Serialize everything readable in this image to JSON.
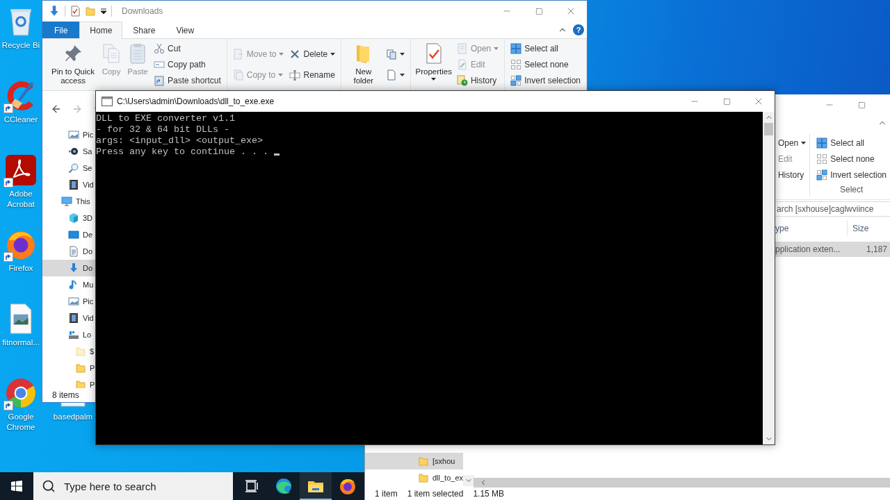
{
  "desktop_icons": [
    {
      "label": "Recycle Bi",
      "kind": "bin",
      "shortcut": false
    },
    {
      "label": "CCleaner",
      "kind": "cleaner",
      "shortcut": true
    },
    {
      "label": "Adobe Acrobat",
      "kind": "pdf",
      "shortcut": true
    },
    {
      "label": "Firefox",
      "kind": "foxbrowser",
      "shortcut": true
    },
    {
      "label": "fitnormal...",
      "kind": "image",
      "shortcut": false
    },
    {
      "label": "Google Chrome",
      "kind": "browser",
      "shortcut": true
    },
    {
      "label": "basedpalm",
      "kind": "file",
      "shortcut": false
    }
  ],
  "taskbar": {
    "search": {
      "placeholder": "Type here to search"
    },
    "apps": [
      {
        "kind": "taskview",
        "active": false
      },
      {
        "kind": "edge",
        "active": false
      },
      {
        "kind": "explorer",
        "active": true
      },
      {
        "kind": "firefox",
        "active": false
      }
    ]
  },
  "explorer_back": {
    "ribbon": {
      "open_items": [
        {
          "label": "Open",
          "dropdown": true,
          "disabled": false
        },
        {
          "label": "Edit",
          "dropdown": false,
          "disabled": true
        },
        {
          "label": "History",
          "dropdown": false,
          "disabled": false
        }
      ],
      "select_group": {
        "label": "Select",
        "items": [
          {
            "label": "Select all",
            "kind": "select-all"
          },
          {
            "label": "Select none",
            "kind": "select-none"
          },
          {
            "label": "Invert selection",
            "kind": "invert-selection"
          }
        ]
      }
    },
    "search": {
      "value": "arch [sxhouse]caglwviince"
    },
    "columns": [
      "ype",
      "Size"
    ],
    "rows": [
      {
        "cells": [
          "pplication exten...",
          "1,187"
        ],
        "selected": true
      }
    ],
    "nav_items": [
      {
        "label": "[sxhou",
        "selected": true
      },
      {
        "label": "dll_to_ex",
        "selected": false
      }
    ],
    "status": [
      "1 item",
      "1 item selected",
      "1.15 MB"
    ]
  },
  "explorer_front": {
    "title": "Downloads",
    "tabs": [
      {
        "label": "File",
        "kind": "file",
        "selected": false
      },
      {
        "label": "Home",
        "kind": "tab",
        "selected": true
      },
      {
        "label": "Share",
        "kind": "tab",
        "selected": false
      },
      {
        "label": "View",
        "kind": "tab",
        "selected": false
      }
    ],
    "help": "?",
    "ribbon": [
      {
        "columns": [
          {
            "large": {
              "label": "Pin to Quick access",
              "kind": "pin",
              "dropdown": false,
              "disabled": false
            }
          },
          {
            "large": {
              "label": "Copy",
              "kind": "copy",
              "dropdown": false,
              "disabled": true
            }
          },
          {
            "large": {
              "label": "Paste",
              "kind": "paste",
              "dropdown": false,
              "disabled": true
            }
          },
          {
            "stack": [
              {
                "label": "Cut",
                "kind": "cut",
                "dropdown": false,
                "disabled": false
              },
              {
                "label": "Copy path",
                "kind": "copy-path",
                "dropdown": false,
                "disabled": false
              },
              {
                "label": "Paste shortcut",
                "kind": "paste-shortcut",
                "dropdown": false,
                "disabled": false
              }
            ]
          }
        ]
      },
      {
        "columns": [
          {
            "stack": [
              {
                "label": "Move to",
                "kind": "move-to",
                "dropdown": true,
                "disabled": true
              },
              {
                "label": "Copy to",
                "kind": "copy-to",
                "dropdown": true,
                "disabled": true
              }
            ]
          },
          {
            "stack": [
              {
                "label": "Delete",
                "kind": "delete",
                "dropdown": true,
                "disabled": false
              },
              {
                "label": "Rename",
                "kind": "rename",
                "dropdown": false,
                "disabled": false
              }
            ]
          }
        ]
      },
      {
        "columns": [
          {
            "large": {
              "label": "New folder",
              "kind": "new-folder",
              "dropdown": false,
              "disabled": false
            }
          },
          {
            "stack": [
              {
                "kind": "new-item",
                "dropdown": true,
                "disabled": false
              },
              {
                "kind": "easy-access",
                "dropdown": true,
                "disabled": false
              }
            ]
          }
        ]
      },
      {
        "columns": [
          {
            "large": {
              "label": "Properties",
              "kind": "properties",
              "dropdown": true,
              "disabled": false
            }
          },
          {
            "stack": [
              {
                "label": "Open",
                "kind": "open",
                "dropdown": true,
                "disabled": true
              },
              {
                "label": "Edit",
                "kind": "edit",
                "dropdown": false,
                "disabled": true
              },
              {
                "label": "History",
                "kind": "history",
                "dropdown": false,
                "disabled": false
              }
            ]
          }
        ]
      },
      {
        "columns": [
          {
            "stack": [
              {
                "label": "Select all",
                "kind": "select-all",
                "dropdown": false,
                "disabled": false
              },
              {
                "label": "Select none",
                "kind": "select-none",
                "dropdown": false,
                "disabled": false
              },
              {
                "label": "Invert selection",
                "kind": "invert-selection",
                "dropdown": false,
                "disabled": false
              }
            ]
          }
        ]
      }
    ],
    "nav": {
      "quick_access": [
        {
          "label": "Pic",
          "kind": "pictures",
          "selected": false
        },
        {
          "label": "Sa",
          "kind": "saved",
          "selected": false
        },
        {
          "label": "Se",
          "kind": "searches",
          "selected": false
        },
        {
          "label": "Vid",
          "kind": "videos",
          "selected": false
        }
      ],
      "tree": [
        {
          "label": "This",
          "kind": "pc",
          "selected": false,
          "children": [
            {
              "label": "3D",
              "kind": "cube",
              "selected": false
            },
            {
              "label": "De",
              "kind": "desktop",
              "selected": false
            },
            {
              "label": "Do",
              "kind": "documents",
              "selected": false
            },
            {
              "label": "Do",
              "kind": "downloads",
              "selected": true
            },
            {
              "label": "Mu",
              "kind": "music",
              "selected": false
            },
            {
              "label": "Pic",
              "kind": "pictures",
              "selected": false
            },
            {
              "label": "Vid",
              "kind": "videos",
              "selected": false
            },
            {
              "label": "Lo",
              "kind": "drive",
              "selected": false,
              "children": [
                {
                  "label": "$",
                  "kind": "hidden-folder",
                  "selected": false
                },
                {
                  "label": "P",
                  "kind": "folder",
                  "selected": false
                },
                {
                  "label": "P",
                  "kind": "folder",
                  "selected": false
                }
              ]
            }
          ]
        }
      ]
    },
    "status": "8 items"
  },
  "console": {
    "title": "C:\\Users\\admin\\Downloads\\dll_to_exe.exe",
    "lines": [
      "DLL to EXE converter v1.1",
      "- for 32 & 64 bit DLLs -",
      "args: <input_dll> <output_exe>",
      "Press any key to continue . . ."
    ],
    "cursor": true
  }
}
